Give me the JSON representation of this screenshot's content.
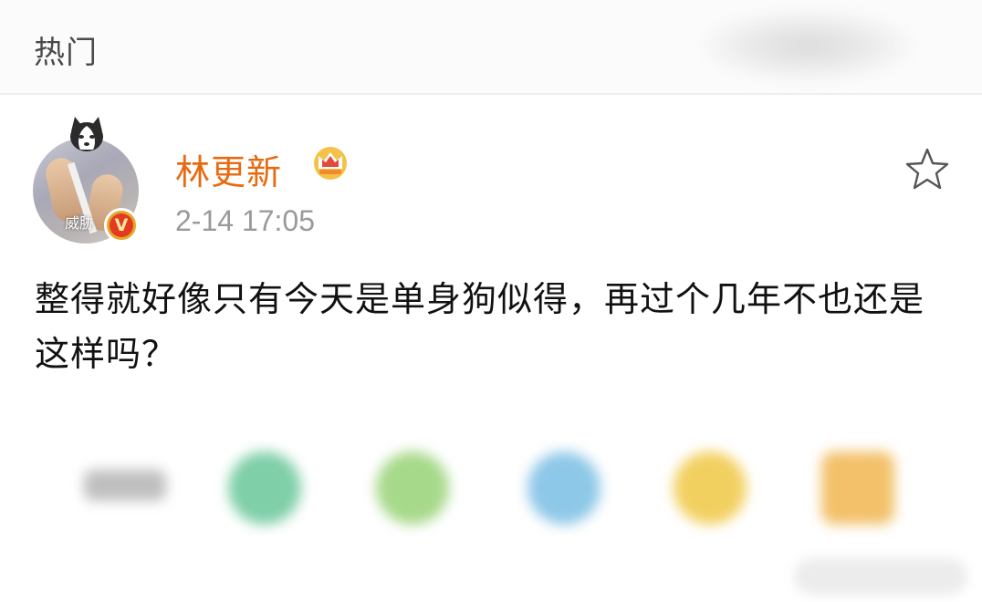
{
  "header": {
    "title": "热门"
  },
  "post": {
    "avatar_label": "威胁",
    "username": "林更新",
    "timestamp": "2-14 17:05",
    "text": "整得就好像只有今天是单身狗似得，再过个几年不也还是这样吗？"
  },
  "icons": {
    "verified_badge": "v-verified-badge-icon",
    "member_crown": "crown-icon",
    "favorite": "star-icon"
  },
  "share_bar": {
    "items": [
      "wechat-icon",
      "moments-icon",
      "qq-icon",
      "favorites-icon",
      "more-icon"
    ]
  },
  "colors": {
    "username": "#e86a10",
    "timestamp": "#9a9a9a",
    "text": "#111111",
    "header_bg": "#fbfbfb"
  }
}
